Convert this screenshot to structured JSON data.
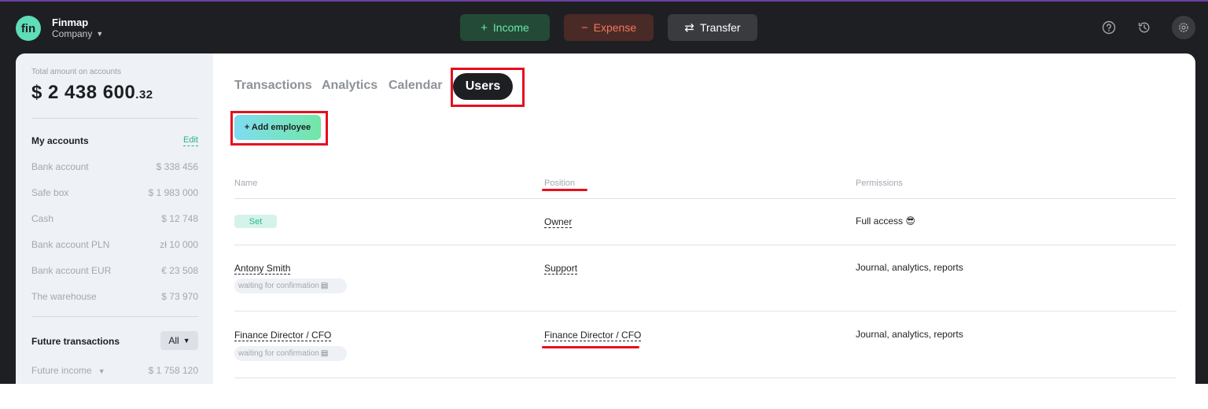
{
  "header": {
    "logo_text": "fin",
    "app_name": "Finmap",
    "company_label": "Company",
    "income_label": "Income",
    "expense_label": "Expense",
    "transfer_label": "Transfer",
    "income_glyph": "+",
    "expense_glyph": "−",
    "transfer_glyph": "⇄"
  },
  "sidebar": {
    "total_label": "Total amount on accounts",
    "total_amount": "$ 2 438 600",
    "total_cents": ".32",
    "my_accounts_title": "My accounts",
    "edit_label": "Edit",
    "accounts": [
      {
        "name": "Bank account",
        "amount": "$ 338 456"
      },
      {
        "name": "Safe box",
        "amount": "$ 1 983 000"
      },
      {
        "name": "Cash",
        "amount": "$ 12 748"
      },
      {
        "name": "Bank account PLN",
        "amount": "zł 10 000"
      },
      {
        "name": "Bank account EUR",
        "amount": "€ 23 508"
      },
      {
        "name": "The warehouse",
        "amount": "$ 73 970"
      }
    ],
    "future_title": "Future transactions",
    "future_filter": "All",
    "future_income_label": "Future income",
    "future_income_amount": "$ 1 758 120"
  },
  "tabs": {
    "transactions": "Transactions",
    "analytics": "Analytics",
    "calendar": "Calendar",
    "users": "Users"
  },
  "add_employee_label": "+ Add employee",
  "table": {
    "headers": {
      "name": "Name",
      "position": "Position",
      "permissions": "Permissions"
    },
    "rows": [
      {
        "name": "Set",
        "position": "Owner",
        "permissions": "Full access",
        "status": ""
      },
      {
        "name": "Antony Smith",
        "position": "Support",
        "permissions": "Journal, analytics, reports",
        "status": "waiting for confirmation"
      },
      {
        "name": "Finance Director / CFO",
        "position": "Finance Director / CFO",
        "permissions": "Journal, analytics, reports",
        "status": "waiting for confirmation"
      }
    ]
  },
  "colors": {
    "accent_green": "#2bb58a",
    "highlight_red": "#e60f1e",
    "income_text": "#6ee7a8",
    "expense_text": "#f2765f"
  }
}
